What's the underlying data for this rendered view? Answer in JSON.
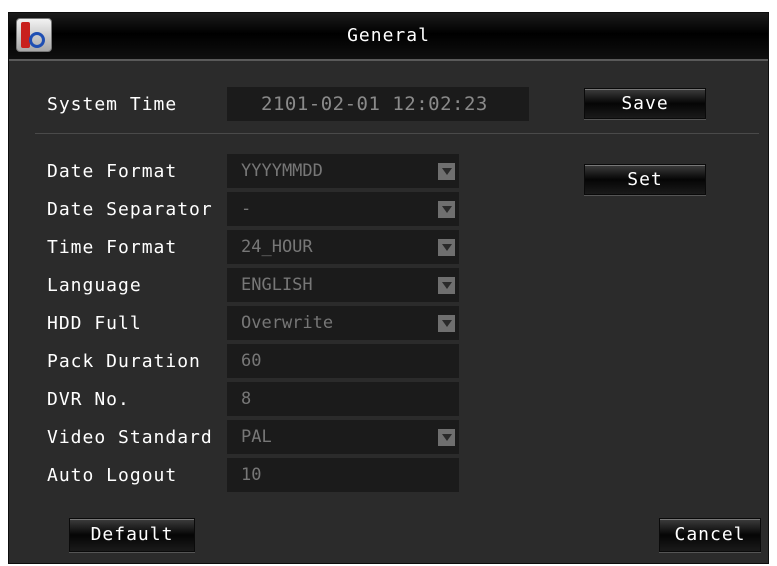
{
  "window": {
    "title": "General"
  },
  "system_time": {
    "label": "System Time",
    "value": "2101-02-01  12:02:23",
    "save_label": "Save"
  },
  "set_label": "Set",
  "fields": {
    "date_format": {
      "label": "Date Format",
      "value": "YYYYMMDD"
    },
    "date_separator": {
      "label": "Date Separator",
      "value": "-"
    },
    "time_format": {
      "label": "Time Format",
      "value": "24_HOUR"
    },
    "language": {
      "label": "Language",
      "value": "ENGLISH"
    },
    "hdd_full": {
      "label": "HDD Full",
      "value": "Overwrite"
    },
    "pack_duration": {
      "label": "Pack Duration",
      "value": "60"
    },
    "dvr_no": {
      "label": "DVR No.",
      "value": "8"
    },
    "video_standard": {
      "label": "Video Standard",
      "value": "PAL"
    },
    "auto_logout": {
      "label": "Auto Logout",
      "value": "10"
    }
  },
  "buttons": {
    "default": "Default",
    "cancel": "Cancel"
  }
}
